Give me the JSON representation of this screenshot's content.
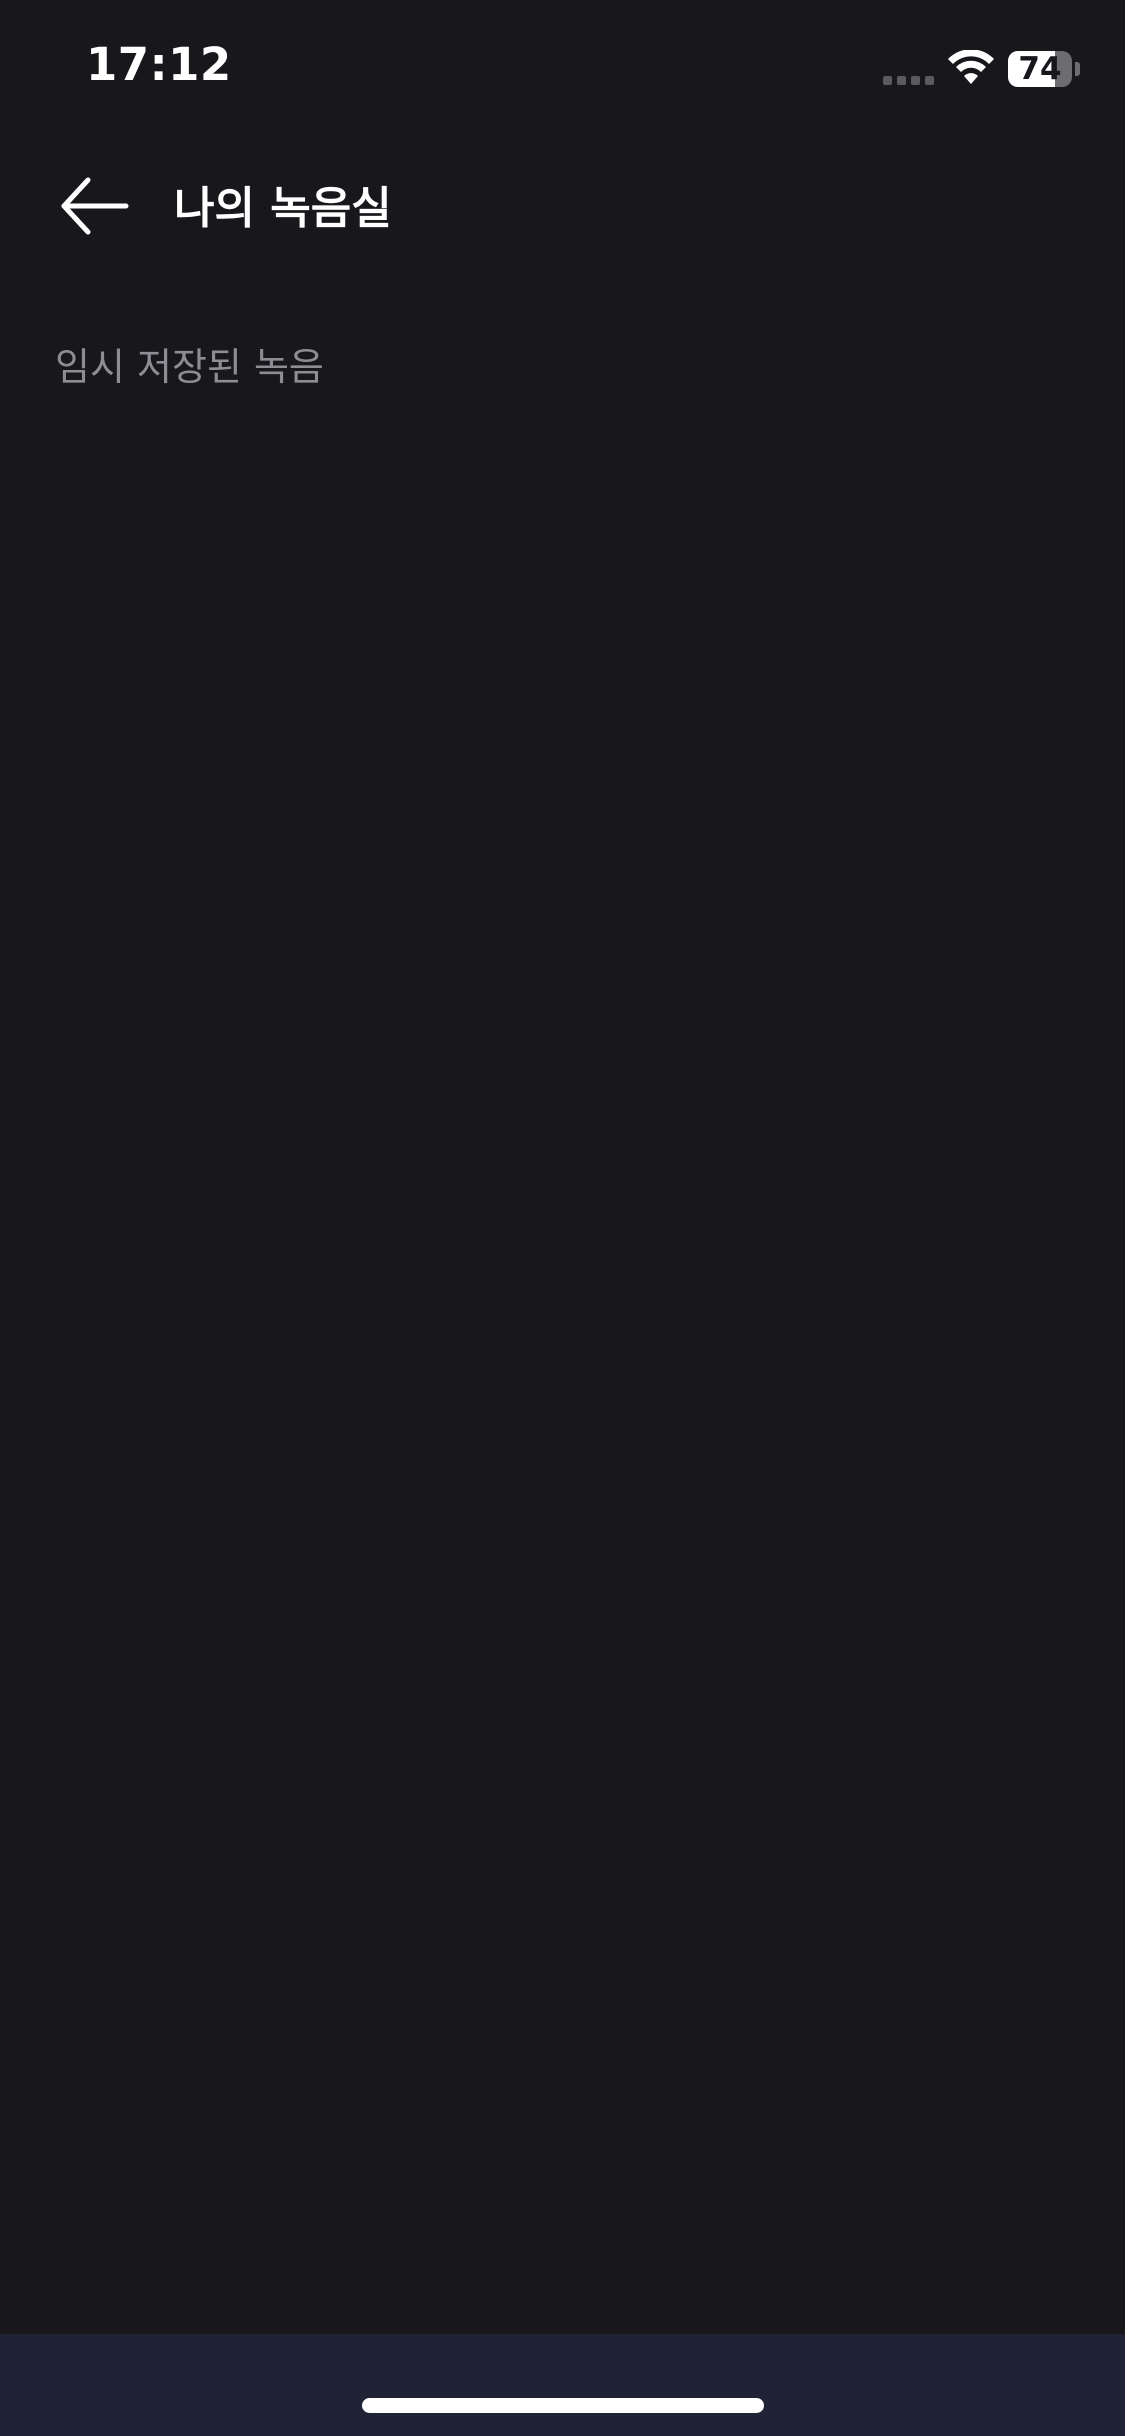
{
  "status_bar": {
    "time": "17:12",
    "battery_percent": "74",
    "battery_level": 0.74,
    "cellular_icon": "cellular-dots-icon",
    "wifi_icon": "wifi-icon",
    "battery_icon": "battery-icon"
  },
  "header": {
    "back_icon": "arrow-left-icon",
    "title": "나의 녹음실"
  },
  "section": {
    "label": "임시 저장된 녹음"
  },
  "colors": {
    "background": "#18171c",
    "bottom_bar": "#202235",
    "title_text": "#ffffff",
    "section_text": "#8e8d93"
  }
}
